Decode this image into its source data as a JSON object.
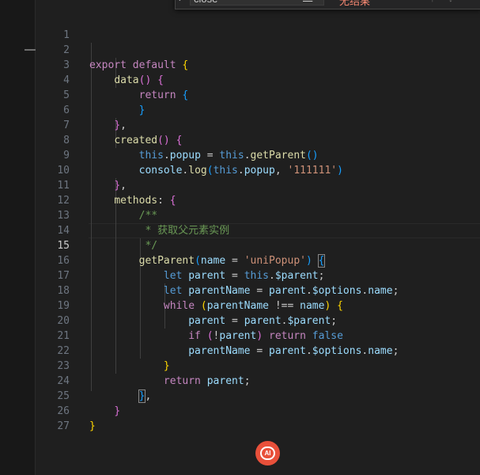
{
  "find_widget": {
    "query": "close",
    "match_case_label": "Aa",
    "whole_word_label": "ab",
    "regex_label": ".*",
    "no_results": "无结果",
    "toggle_icon": "chevron-right-icon",
    "prev_icon": "arrow-up-icon",
    "next_icon": "arrow-down-icon"
  },
  "editor": {
    "active_line": 15,
    "lines": [
      {
        "n": "1"
      },
      {
        "n": "2"
      },
      {
        "n": "3"
      },
      {
        "n": "4"
      },
      {
        "n": "5"
      },
      {
        "n": "6"
      },
      {
        "n": "7"
      },
      {
        "n": "8"
      },
      {
        "n": "9"
      },
      {
        "n": "10"
      },
      {
        "n": "11"
      },
      {
        "n": "12"
      },
      {
        "n": "13"
      },
      {
        "n": "14"
      },
      {
        "n": "15"
      },
      {
        "n": "16"
      },
      {
        "n": "17"
      },
      {
        "n": "18"
      },
      {
        "n": "19"
      },
      {
        "n": "20"
      },
      {
        "n": "21"
      },
      {
        "n": "22"
      },
      {
        "n": "23"
      },
      {
        "n": "24"
      },
      {
        "n": "25"
      },
      {
        "n": "26"
      },
      {
        "n": "27"
      }
    ],
    "tokens": {
      "export_default": "export default",
      "data": "data",
      "return": "return",
      "created": "created",
      "this": "this",
      "popup": "popup",
      "getParent": "getParent",
      "console": "console",
      "log": "log",
      "str_111111": "'111111'",
      "methods": "methods",
      "doc_open": "/**",
      "doc_desc": " * 获取父元素实例",
      "doc_close": " */",
      "name": "name",
      "str_uniPopup": "'uniPopup'",
      "let": "let",
      "parent": "parent",
      "dollar_parent": "$parent",
      "parentName": "parentName",
      "dollar_options": "$options",
      "while": "while",
      "neq": "!==",
      "if": "if",
      "false": "false"
    }
  },
  "colors": {
    "background": "#1f1f1f",
    "keyword": "#c586c0",
    "storage": "#569cd6",
    "function": "#dcdcaa",
    "variable": "#9cdcfe",
    "string": "#ce9178",
    "comment": "#6a9955",
    "ai_badge": "#e8503a"
  },
  "ai_badge": {
    "label": "AI",
    "icon": "ai-assistant-icon"
  }
}
